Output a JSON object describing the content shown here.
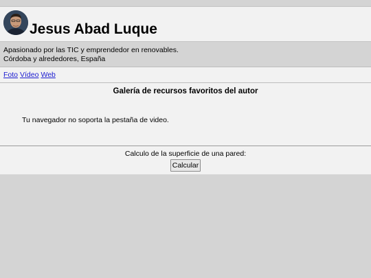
{
  "header": {
    "name": "Jesus Abad Luque"
  },
  "info": {
    "line1": "Apasionado por las TIC y emprendedor en renovables.",
    "line2": "Córdoba y alrededores, España"
  },
  "links": [
    {
      "label": "Foto"
    },
    {
      "label": "Vídeo"
    },
    {
      "label": "Web"
    }
  ],
  "gallery": {
    "title": "Galería de recursos favoritos del autor",
    "video_message": "Tu navegador no soporta la pestaña de video."
  },
  "calc": {
    "label": "Calculo de la superficie de una pared:",
    "button_label": "Calcular"
  },
  "colors": {
    "link": "#1a1ad0",
    "background": "#d4d4d4",
    "panel": "#f2f2f2"
  }
}
